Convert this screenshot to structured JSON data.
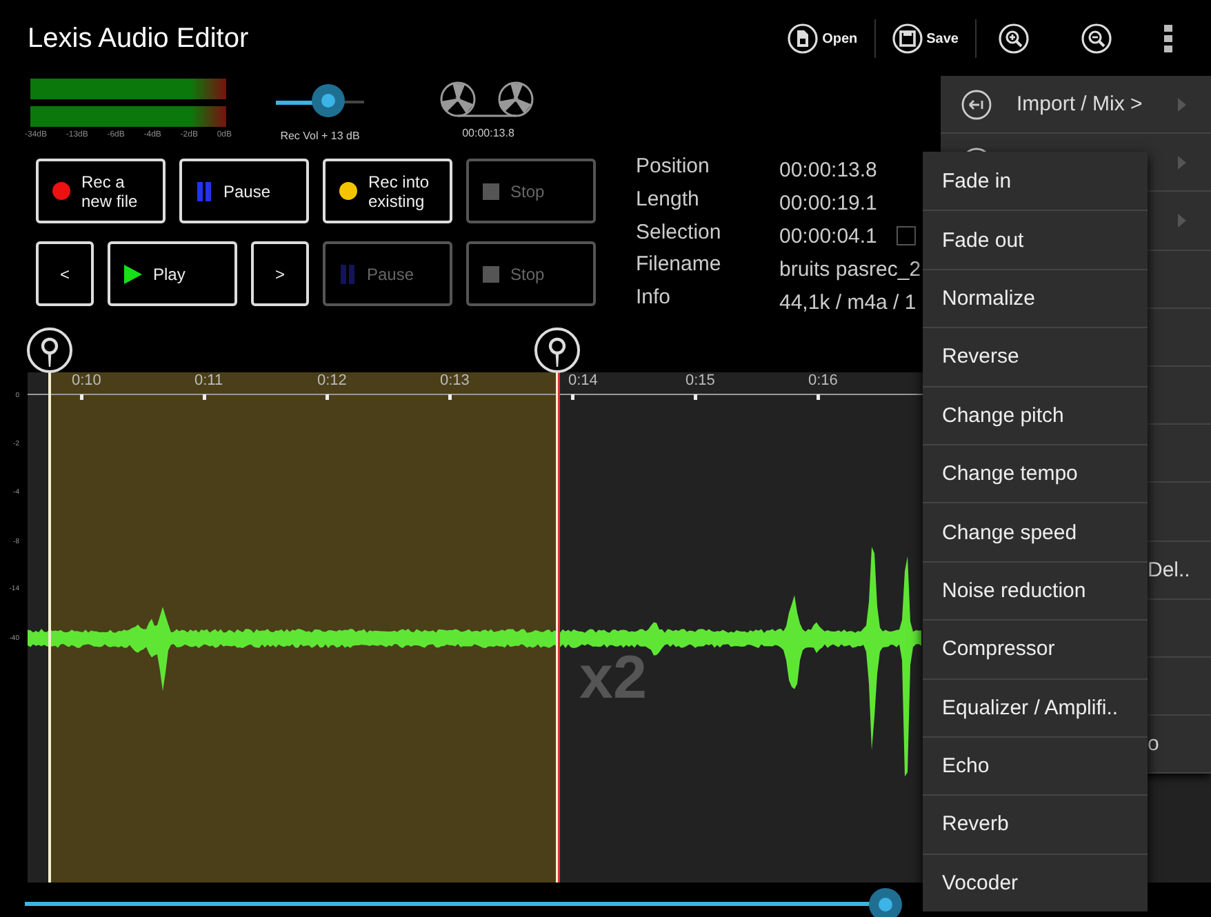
{
  "app_title": "Lexis Audio Editor",
  "toolbar": [
    {
      "kind": "open",
      "label": "Open"
    },
    {
      "kind": "save",
      "label": "Save"
    },
    {
      "kind": "zoom-in"
    },
    {
      "kind": "zoom-out"
    },
    {
      "kind": "more"
    }
  ],
  "meter": {
    "channels": [
      {
        "level": 1
      },
      {
        "level": 1
      }
    ],
    "scale": [
      "-34dB",
      "-13dB",
      "-6dB",
      "-4dB",
      "-2dB",
      "0dB"
    ]
  },
  "rec_volume": {
    "level": 0.6,
    "label": "Rec Vol + 13 dB"
  },
  "reels_time": "00:00:13.8",
  "button_rows": [
    [
      {
        "kind": "record",
        "label": "Rec a new file",
        "disabled": false
      },
      {
        "kind": "pause",
        "label": "Pause",
        "disabled": false
      },
      {
        "kind": "rec-into",
        "label": "Rec into existing",
        "disabled": false
      },
      {
        "kind": "stop",
        "label": "Stop",
        "disabled": true
      }
    ],
    [
      {
        "kind": "prev",
        "label": "<",
        "disabled": false
      },
      {
        "kind": "play",
        "label": "Play",
        "disabled": false
      },
      {
        "kind": "next",
        "label": ">",
        "disabled": false
      },
      {
        "kind": "pause",
        "label": "Pause",
        "disabled": true
      },
      {
        "kind": "stop",
        "label": "Stop",
        "disabled": true
      }
    ]
  ],
  "info": [
    {
      "label": "Position",
      "value": "00:00:13.8"
    },
    {
      "label": "Length",
      "value": "00:00:19.1"
    },
    {
      "label": "Selection",
      "value": "00:00:04.1",
      "checkbox": {
        "checked": false
      }
    },
    {
      "label": "Filename",
      "value": "bruits pasrec_2"
    },
    {
      "label": "Info",
      "value": "44,1k / m4a / 1"
    }
  ],
  "timeline": {
    "ticks": [
      "0:10",
      "0:11",
      "0:12",
      "0:13",
      "0:14",
      "0:15",
      "0:16"
    ],
    "y_labels": [
      "0",
      "-2",
      "-4",
      "-8",
      "-14",
      "-40"
    ],
    "zoom": "x2"
  },
  "position_slider": {
    "level": 0.99
  },
  "menu_back": [
    {
      "label": "Import / Mix >",
      "icon": true,
      "submenu": true
    },
    {
      "icon": true,
      "submenu": true
    },
    {
      "submenu": true
    },
    {
      "submenu": false
    },
    {
      "submenu": false
    },
    {
      "submenu": false
    },
    {
      "submenu": false
    },
    {
      "submenu": false
    },
    {
      "label_tail": "Del..",
      "submenu": false
    },
    {
      "submenu": false
    },
    {
      "submenu": false
    },
    {
      "label_tail": "o",
      "submenu": false
    }
  ],
  "menu_front": [
    "Fade in",
    "Fade out",
    "Normalize",
    "Reverse",
    "Change pitch",
    "Change tempo",
    "Change speed",
    "Noise reduction",
    "Compressor",
    "Equalizer / Amplifi..",
    "Echo",
    "Reverb",
    "Vocoder"
  ]
}
